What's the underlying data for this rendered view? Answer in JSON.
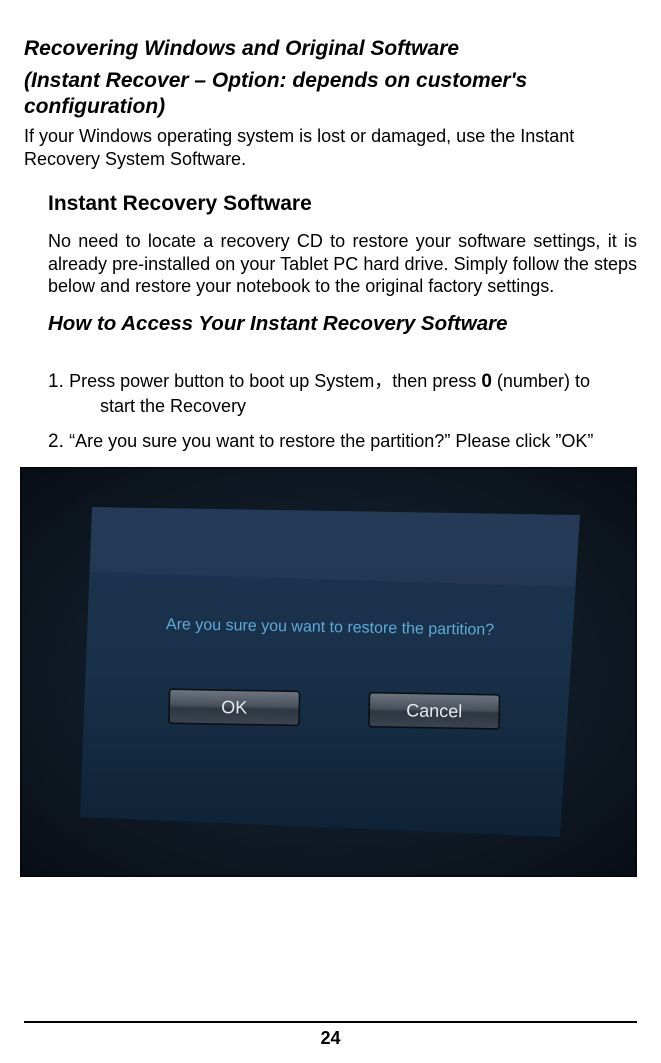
{
  "title1": "Recovering Windows and Original Software",
  "title2": "(Instant Recover – Option:  depends on customer's configuration)",
  "intro": "If your Windows operating system is lost or damaged, use the Instant Recovery System Software.",
  "subhead": "Instant Recovery Software",
  "body": "No need to locate a recovery CD to restore your software settings, it is already pre-installed on your Tablet PC hard drive. Simply follow the steps below and restore your notebook to the original factory settings.",
  "howto": "How to Access Your Instant Recovery Software",
  "step1_a": "Press power button to boot up System，then press ",
  "step1_zero": "0",
  "step1_b": " (number) to ",
  "step1_cont": "start the Recovery",
  "step2": "“Are you sure you want to restore the partition?” Please click ”OK”",
  "dialog_text": "Are you sure you want to restore the partition?",
  "ok": "OK",
  "cancel": "Cancel",
  "page_number": "24"
}
